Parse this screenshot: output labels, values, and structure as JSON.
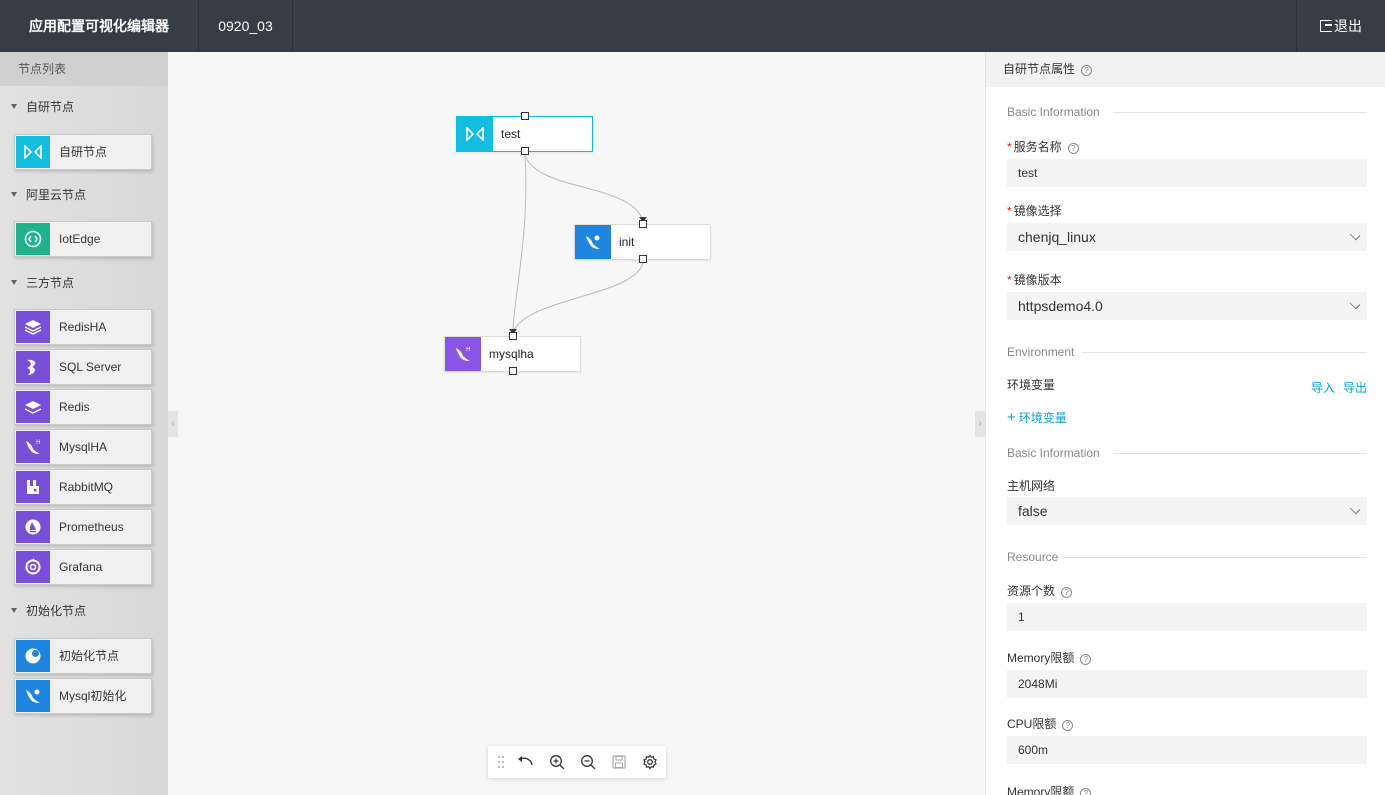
{
  "header": {
    "title": "应用配置可视化编辑器",
    "app_name": "0920_03",
    "logout_label": "退出"
  },
  "sidebar": {
    "title": "节点列表",
    "groups": [
      {
        "label": "自研节点",
        "items": [
          {
            "label": "自研节点",
            "icon": "bowtie-icon",
            "color": "#12bde0"
          }
        ]
      },
      {
        "label": "阿里云节点",
        "items": [
          {
            "label": "IotEdge",
            "icon": "iot-edge-icon",
            "color": "#1fb28b"
          }
        ]
      },
      {
        "label": "三方节点",
        "items": [
          {
            "label": "RedisHA",
            "icon": "redis-ha-icon",
            "color": "#7a4fd8"
          },
          {
            "label": "SQL Server",
            "icon": "sql-server-icon",
            "color": "#7a4fd8"
          },
          {
            "label": "Redis",
            "icon": "redis-icon",
            "color": "#7a4fd8"
          },
          {
            "label": "MysqlHA",
            "icon": "mysql-ha-icon",
            "color": "#7a4fd8"
          },
          {
            "label": "RabbitMQ",
            "icon": "rabbitmq-icon",
            "color": "#7a4fd8"
          },
          {
            "label": "Prometheus",
            "icon": "prometheus-icon",
            "color": "#7a4fd8"
          },
          {
            "label": "Grafana",
            "icon": "grafana-icon",
            "color": "#7a4fd8"
          }
        ]
      },
      {
        "label": "初始化节点",
        "items": [
          {
            "label": "初始化节点",
            "icon": "init-node-icon",
            "color": "#1f86e0"
          },
          {
            "label": "Mysql初始化",
            "icon": "mysql-init-icon",
            "color": "#1f86e0"
          }
        ]
      }
    ]
  },
  "canvas": {
    "nodes": [
      {
        "label": "test",
        "icon": "bowtie-icon",
        "color": "#12bde0",
        "selected": true
      },
      {
        "label": "init",
        "icon": "dolphin-icon",
        "color": "#1f86e0",
        "selected": false
      },
      {
        "label": "mysqlha",
        "icon": "mysql-ha-icon",
        "color": "#8a55e6",
        "selected": false
      }
    ],
    "edges": [
      [
        "test",
        "init"
      ],
      [
        "test",
        "mysqlha"
      ],
      [
        "init",
        "mysqlha"
      ]
    ],
    "toolbar": [
      "drag-handle-icon",
      "undo-icon",
      "zoom-in-icon",
      "zoom-out-icon",
      "save-icon",
      "settings-icon"
    ]
  },
  "panel": {
    "title": "自研节点属性",
    "section_basic": "Basic Information",
    "service_name_label": "服务名称",
    "service_name_value": "test",
    "image_label": "镜像选择",
    "image_value": "chenjq_linux",
    "image_version_label": "镜像版本",
    "image_version_value": "httpsdemo4.0",
    "section_env": "Environment",
    "env_label": "环境变量",
    "import_label": "导入",
    "export_label": "导出",
    "add_env_label": "环境变量",
    "section_basic2": "Basic Information",
    "host_network_label": "主机网络",
    "host_network_value": "false",
    "section_resource": "Resource",
    "resource_count_label": "资源个数",
    "resource_count_value": "1",
    "memory_label": "Memory限额",
    "memory_value": "2048Mi",
    "cpu_label": "CPU限额",
    "cpu_value": "600m",
    "next_label": "Memory限额"
  }
}
